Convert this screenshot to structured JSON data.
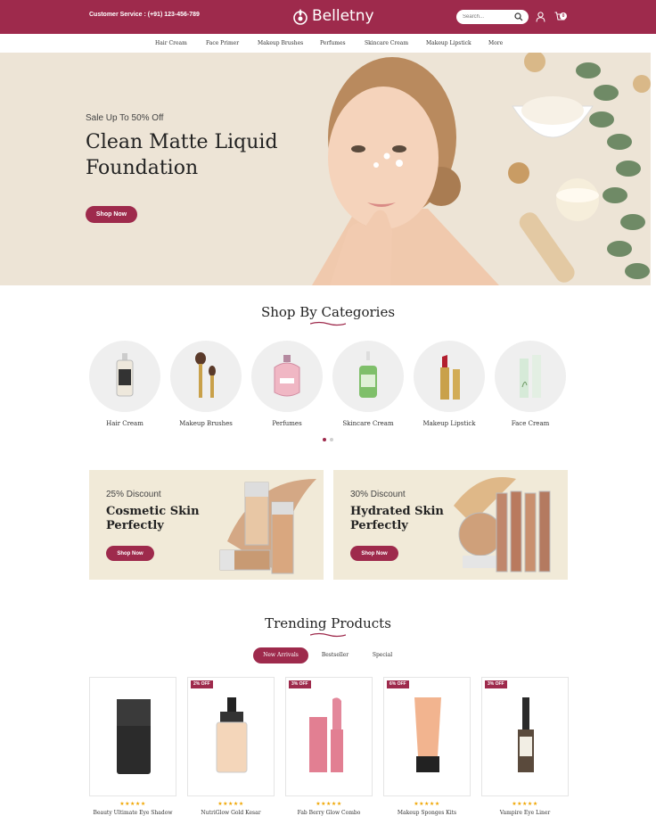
{
  "header": {
    "customer_service": "Customer Service :  (+91) 123-456-789",
    "brand": "Belletny",
    "search_placeholder": "Search...",
    "cart_count": "0",
    "icons": [
      "logo-icon",
      "search-icon",
      "user-icon",
      "cart-icon"
    ]
  },
  "nav": {
    "items": [
      "Hair Cream",
      "Face Primer",
      "Makeup Brushes",
      "Perfumes",
      "Skincare Cream",
      "Makeup Lipstick",
      "More"
    ]
  },
  "hero": {
    "sub": "Sale Up To 50% Off",
    "title_line1": "Clean Matte Liquid",
    "title_line2": "Foundation",
    "button": "Shop Now"
  },
  "categories": {
    "title": "Shop By Categories",
    "items": [
      "Hair Cream",
      "Makeup Brushes",
      "Perfumes",
      "Skincare Cream",
      "Makeup Lipstick",
      "Face Cream"
    ]
  },
  "banners": [
    {
      "discount": "25% Discount",
      "title": "Cosmetic Skin Perfectly",
      "button": "Shop Now"
    },
    {
      "discount": "30% Discount",
      "title": "Hydrated Skin Perfectly",
      "button": "Shop Now"
    }
  ],
  "trending": {
    "title": "Trending Products",
    "tabs": [
      "New Arrivals",
      "Bestseller",
      "Special"
    ],
    "active_tab": "New Arrivals",
    "products": [
      {
        "badge": "",
        "name": "Beauty Ultimate Eye Shadow",
        "stars": "★★★★★"
      },
      {
        "badge": "2% OFF",
        "name": "NutriGlow Gold Kesar",
        "stars": "★★★★★"
      },
      {
        "badge": "3% OFF",
        "name": "Fab Berry Glow Combo",
        "stars": "★★★★★"
      },
      {
        "badge": "6% OFF",
        "name": "Makeup Sponges Kits",
        "stars": "★★★★★"
      },
      {
        "badge": "3% OFF",
        "name": "Vampire Eye Liner",
        "stars": "★★★★★"
      }
    ]
  },
  "colors": {
    "brand": "#9e2a4c",
    "hero_bg": "#ede4d6",
    "banner_bg": "#f1ead8",
    "star": "#f0a500"
  }
}
